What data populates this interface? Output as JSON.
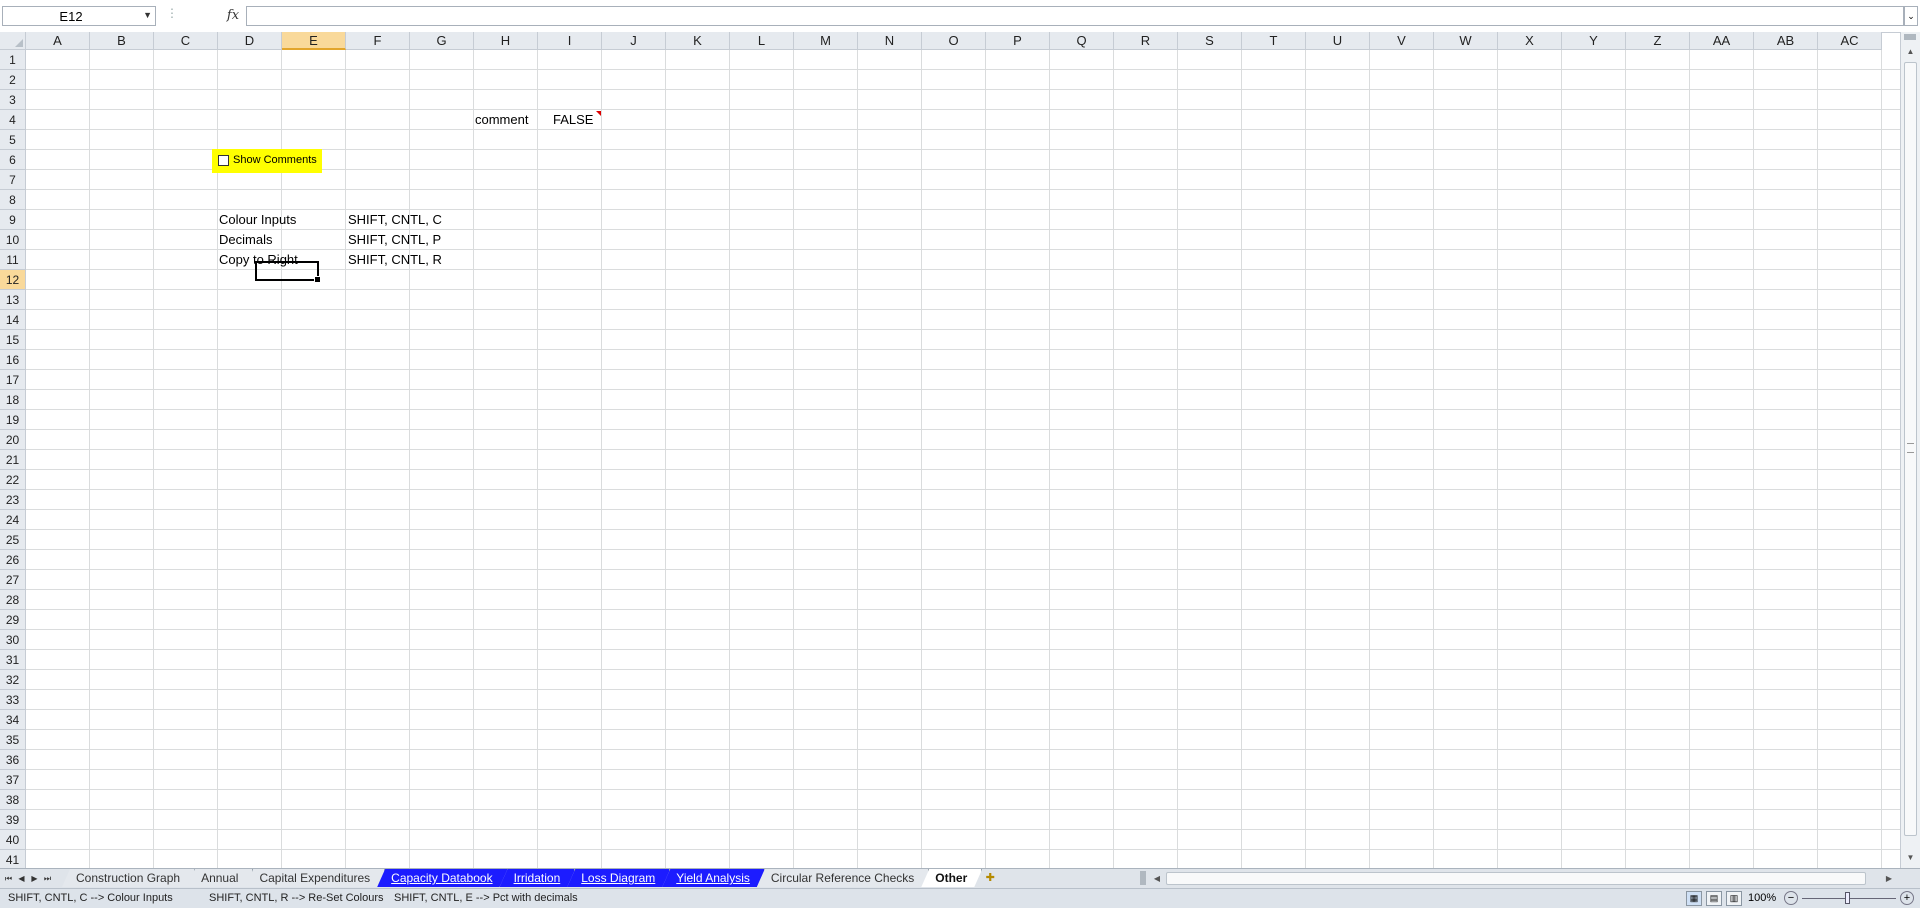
{
  "formula_bar": {
    "name_box": "E12",
    "fx_label": "fx",
    "formula": ""
  },
  "columns": [
    "A",
    "B",
    "C",
    "D",
    "E",
    "F",
    "G",
    "H",
    "I",
    "J",
    "K",
    "L",
    "M",
    "N",
    "O",
    "P",
    "Q",
    "R",
    "S",
    "T",
    "U",
    "V",
    "W",
    "X",
    "Y",
    "Z",
    "AA",
    "AB",
    "AC"
  ],
  "rows": [
    "1",
    "2",
    "3",
    "4",
    "5",
    "6",
    "7",
    "8",
    "9",
    "10",
    "11",
    "12",
    "13",
    "14",
    "15",
    "16",
    "17",
    "18",
    "19",
    "20",
    "21",
    "22",
    "23",
    "24",
    "25",
    "26",
    "27",
    "28",
    "29",
    "30",
    "31",
    "32",
    "33",
    "34",
    "35",
    "36",
    "37",
    "38",
    "39",
    "40",
    "41"
  ],
  "selected": {
    "column": "E",
    "row": "12"
  },
  "cells": {
    "h4": "comment",
    "i4": "FALSE",
    "d9": "Colour Inputs",
    "f9": "SHIFT, CNTL, C",
    "d10": "Decimals",
    "f10": "SHIFT, CNTL, P",
    "d11": "Copy to Right",
    "f11": "SHIFT, CNTL, R"
  },
  "checkbox": {
    "label": "Show Comments",
    "checked": false,
    "fill_color": "#ffff00"
  },
  "sheet_tabs": [
    {
      "label": "Construction Graph",
      "style": "normal"
    },
    {
      "label": "Annual",
      "style": "normal"
    },
    {
      "label": "Capital Expenditures",
      "style": "normal"
    },
    {
      "label": "Capacity Databook",
      "style": "blue"
    },
    {
      "label": "Irridation",
      "style": "blue"
    },
    {
      "label": "Loss Diagram",
      "style": "blue"
    },
    {
      "label": "Yield Analysis",
      "style": "blue"
    },
    {
      "label": "Circular Reference Checks",
      "style": "normal"
    },
    {
      "label": "Other",
      "style": "active"
    }
  ],
  "status_bar": {
    "msg1": "SHIFT, CNTL, C --> Colour Inputs",
    "msg2": "SHIFT, CNTL, R --> Re-Set Colours",
    "msg3": "SHIFT, CNTL, E --> Pct with decimals",
    "zoom": "100%"
  },
  "colors": {
    "accent_tab": "#1c1cff",
    "selected_header": "#f9d99a",
    "comment_marker": "#dd0000"
  },
  "icons": [
    "dropdown-arrow-icon",
    "fx-icon",
    "new-sheet-icon",
    "normal-view-icon",
    "page-layout-icon",
    "page-break-icon",
    "zoom-out-icon",
    "zoom-in-icon"
  ]
}
